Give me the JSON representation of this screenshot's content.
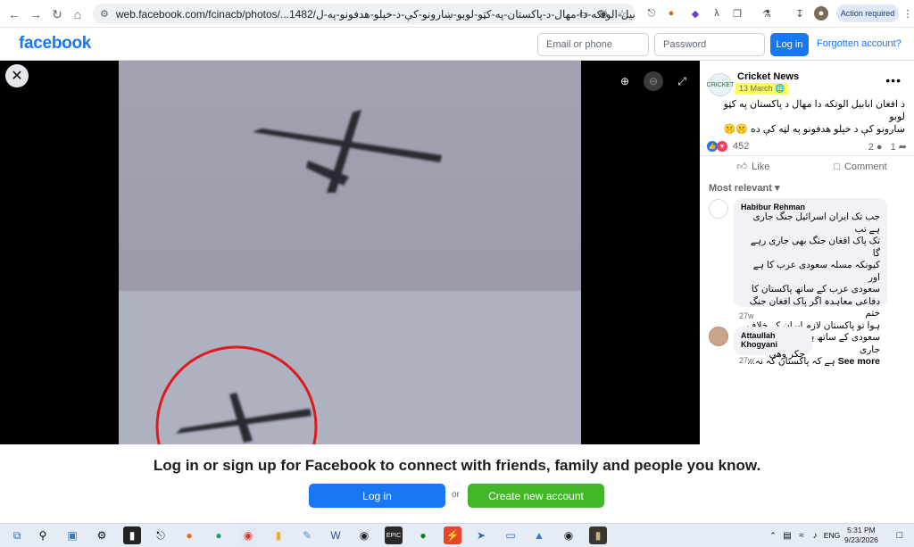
{
  "browser": {
    "url": "web.facebook.com/fcinacb/photos/...1482/د-افغان-ابابیل-الوتکه-دا-مهال-د-پاکستان-په-کټو-لوبو-ښارونو-کې-د-خپلو-هدفونو-په-ل",
    "action_required": "Action required"
  },
  "fb_header": {
    "logo": "facebook",
    "email_placeholder": "Email or phone",
    "password_placeholder": "Password",
    "login": "Log in",
    "forgot": "Forgotten account?"
  },
  "photo_viewer": {
    "close_icon": "close-icon",
    "zoom_in_icon": "zoom-in-icon",
    "zoom_out_icon": "zoom-out-icon",
    "fullscreen_icon": "fullscreen-icon"
  },
  "post": {
    "page_name": "Cricket News",
    "date": "13 March",
    "avatar_text": "CRICKET",
    "text_line1": "د افغان ابابیل الوتکه دا مهال د پاکستان په کټو لوبو",
    "text_line2": "ښارونو کې د خپلو هدفونو په لټه کې ده 🤫🤫",
    "reaction_count": "452",
    "comment_count": "2",
    "share_count": "1",
    "like_label": "Like",
    "comment_label": "Comment",
    "sort_label": "Most relevant"
  },
  "comments": [
    {
      "author": "Habibur Rehman",
      "lines": [
        "جب تک ایران اسرائیل جنگ جاری ہے تب",
        "تک پاک افغان جنگ بھی جاری رہے گا",
        "کیونکہ مسلہ سعودی عرب کا ہے اور",
        "سعودی عرب کے ساتھ پاکستان کا",
        "دفاعی معاہدہ اگر پاک افغان جنگ ختم",
        "ہوا تو پاکستان لازم ایران کے خلاف",
        "سعودی کے ساتھ ہوگا اس یہ جنگ جاری",
        "ہے کہ پاکستان کہ نہ..."
      ],
      "see_more": "See more",
      "time": "27w"
    },
    {
      "author": "Attaullah Khogyani",
      "lines": [
        "چکر وهی"
      ],
      "time": "27w"
    }
  ],
  "banner": {
    "title": "Log in or sign up for Facebook to connect with friends, family and people you know.",
    "login": "Log in",
    "or": "or",
    "create": "Create new account"
  },
  "taskbar": {
    "language": "ENG",
    "time": "5:31 PM",
    "date": "9/23/2026"
  },
  "colors": {
    "facebook_blue": "#1877f2",
    "create_green": "#42b72a",
    "date_highlight": "#ffff5c",
    "circle_annotation": "#e0191e"
  }
}
